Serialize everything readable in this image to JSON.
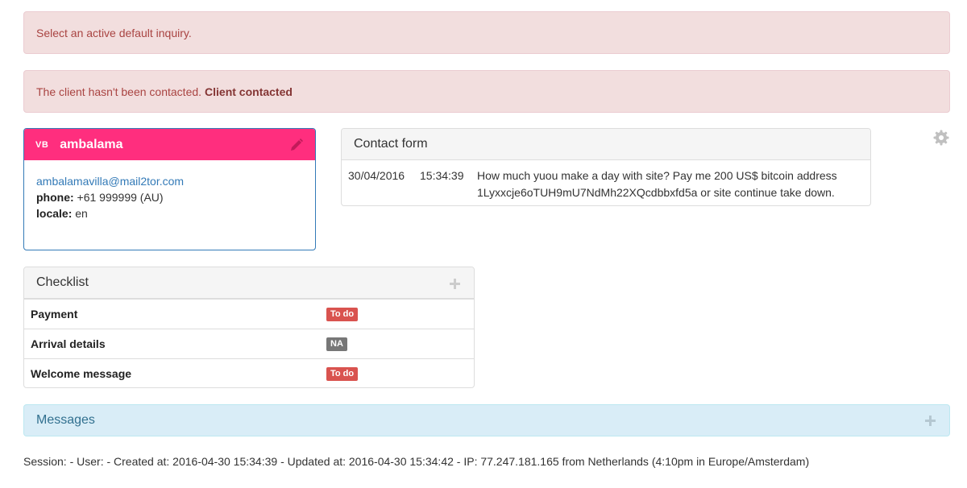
{
  "alerts": {
    "inquiry": "Select an active default inquiry.",
    "contact_text": "The client hasn't been contacted.",
    "contact_link": "Client contacted"
  },
  "guest": {
    "initials": "VB",
    "name": "ambalama",
    "email": "ambalamavilla@mail2tor.com",
    "phone_label": "phone:",
    "phone": "+61 999999 (AU)",
    "locale_label": "locale:",
    "locale": "en",
    "header_color": "#ff2e7e",
    "edit_icon": "pencil-icon"
  },
  "contact_form": {
    "title": "Contact form",
    "entries": [
      {
        "date": "30/04/2016",
        "time": "15:34:39",
        "message": "How much yuou make a day with site? Pay me 200 US$ bitcoin address 1Lyxxcje6oTUH9mU7NdMh22XQcdbbxfd5a or site continue take down."
      }
    ]
  },
  "settings_icon": "gear-icon",
  "checklist": {
    "title": "Checklist",
    "items": [
      {
        "name": "Payment",
        "status": "To do",
        "status_color": "#d9534f"
      },
      {
        "name": "Arrival details",
        "status": "NA",
        "status_color": "#777777"
      },
      {
        "name": "Welcome message",
        "status": "To do",
        "status_color": "#d9534f"
      }
    ]
  },
  "messages": {
    "title": "Messages"
  },
  "footer": {
    "text": "Session: - User: - Created at: 2016-04-30 15:34:39 - Updated at: 2016-04-30 15:34:42 - IP: 77.247.181.165 from Netherlands (4:10pm in Europe/Amsterdam)"
  }
}
